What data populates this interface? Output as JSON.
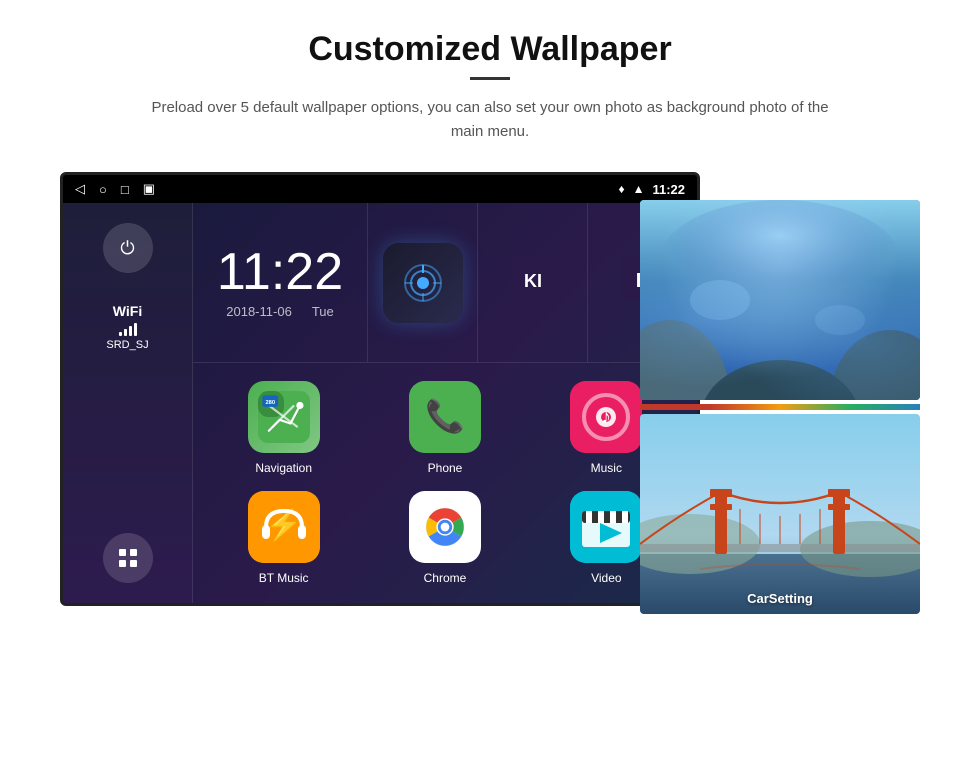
{
  "page": {
    "title": "Customized Wallpaper",
    "underline": true,
    "subtitle": "Preload over 5 default wallpaper options, you can also set your own photo as background photo of the main menu."
  },
  "device": {
    "statusBar": {
      "time": "11:22",
      "icons": [
        "back",
        "home",
        "recents",
        "screenshot"
      ],
      "rightIcons": [
        "location",
        "wifi"
      ]
    },
    "clock": {
      "time": "11:22",
      "date": "2018-11-06",
      "day": "Tue"
    },
    "sidebar": {
      "powerBtn": "⏻",
      "wifi": {
        "label": "WiFi",
        "network": "SRD_SJ"
      },
      "gridBtn": "⊞"
    },
    "apps": [
      {
        "name": "Navigation",
        "type": "navigation",
        "label": "Navigation"
      },
      {
        "name": "Phone",
        "type": "phone",
        "label": "Phone"
      },
      {
        "name": "Music",
        "type": "music",
        "label": "Music"
      },
      {
        "name": "BT Music",
        "type": "btmusic",
        "label": "BT Music"
      },
      {
        "name": "Chrome",
        "type": "chrome",
        "label": "Chrome"
      },
      {
        "name": "Video",
        "type": "video",
        "label": "Video"
      }
    ],
    "topIcons": [
      {
        "type": "radio",
        "label": ""
      },
      {
        "type": "text",
        "text": "KI",
        "label": ""
      },
      {
        "type": "text",
        "text": "B",
        "label": ""
      }
    ]
  },
  "wallpapers": [
    {
      "name": "IceCave",
      "label": ""
    },
    {
      "name": "CarSetting",
      "label": "CarSetting"
    },
    {
      "name": "GoldenGate",
      "label": ""
    }
  ]
}
